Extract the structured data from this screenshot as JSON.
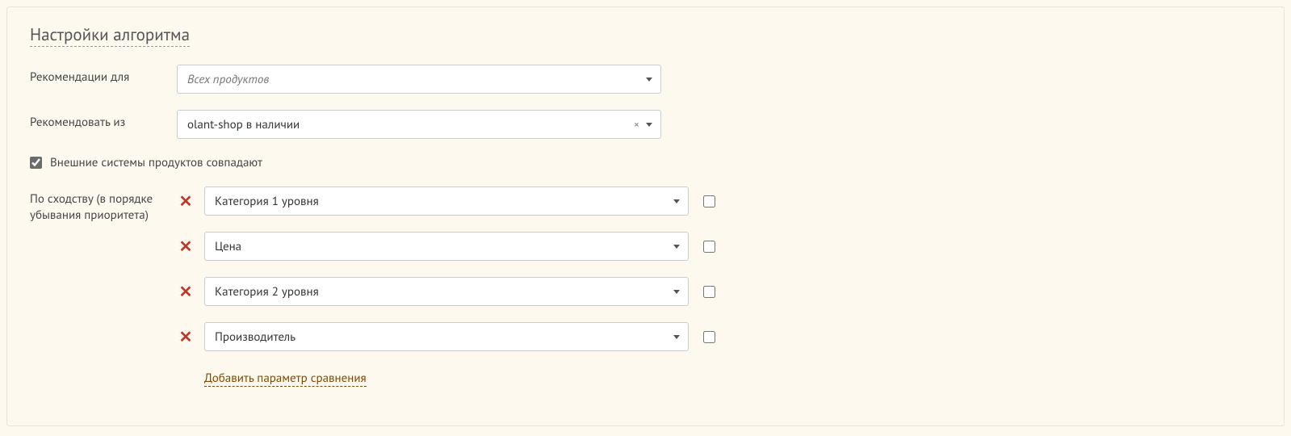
{
  "section": {
    "title": "Настройки алгоритма"
  },
  "fields": {
    "recommend_for_label": "Рекомендации для",
    "recommend_for_value": "Всех продуктов",
    "recommend_from_label": "Рекомендовать из",
    "recommend_from_value": "olant-shop в наличии",
    "external_match_label": "Внешние системы продуктов совпадают",
    "external_match_checked": true,
    "similarity_label": "По сходству (в порядке убывания приоритета)"
  },
  "similarity_items": [
    {
      "value": "Категория 1 уровня",
      "trailing_checked": false
    },
    {
      "value": "Цена",
      "trailing_checked": false
    },
    {
      "value": "Категория 2 уровня",
      "trailing_checked": false
    },
    {
      "value": "Производитель",
      "trailing_checked": false
    }
  ],
  "add_link_label": "Добавить параметр сравнения"
}
